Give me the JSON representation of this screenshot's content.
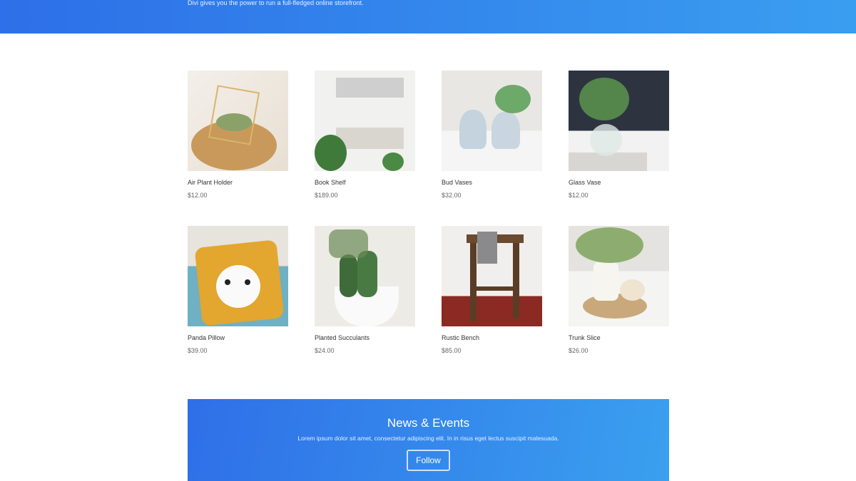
{
  "hero": {
    "subtitle": "Divi gives you the power to run a full-fledged online storefront."
  },
  "products": [
    {
      "name": "Air Plant Holder",
      "price": "$12.00"
    },
    {
      "name": "Book Shelf",
      "price": "$189.00"
    },
    {
      "name": "Bud Vases",
      "price": "$32.00"
    },
    {
      "name": "Glass Vase",
      "price": "$12.00"
    },
    {
      "name": "Panda Pillow",
      "price": "$39.00"
    },
    {
      "name": "Planted Succulants",
      "price": "$24.00"
    },
    {
      "name": "Rustic Bench",
      "price": "$85.00"
    },
    {
      "name": "Trunk Slice",
      "price": "$26.00"
    }
  ],
  "newsletter": {
    "title": "News & Events",
    "text": "Lorem ipsum dolor sit amet, consectetur adipiscing elit. In in risus eget lectus suscipit malesuada.",
    "button": "Follow"
  },
  "colors": {
    "accent_start": "#2d6fe8",
    "accent_end": "#3a9ef0"
  }
}
